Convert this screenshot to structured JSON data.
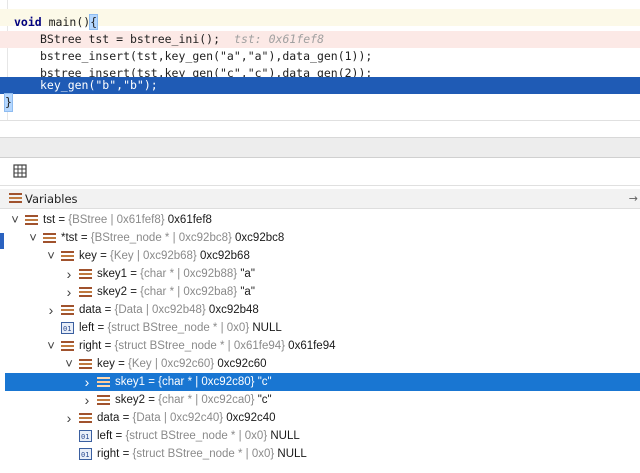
{
  "editor": {
    "lines": [
      {
        "kind": "func",
        "kw": "void",
        "rest": " main()",
        "brace": "{"
      },
      {
        "kind": "current",
        "text": "BStree tst = bstree_ini();",
        "hint": "tst: 0x61fef8"
      },
      {
        "kind": "normal",
        "text": "bstree_insert(tst,key_gen(\"a\",\"a\"),data_gen(1));"
      },
      {
        "kind": "normal",
        "text": "bstree_insert(tst,key_gen(\"c\",\"c\"),data_gen(2));"
      },
      {
        "kind": "selected",
        "text": "key_gen(\"b\",\"b\");"
      },
      {
        "kind": "closing",
        "text": "}"
      }
    ]
  },
  "toolbar": {
    "table_icon": "table-view-icon"
  },
  "variables_pane": {
    "title": "Variables",
    "pin_glyph": "→",
    "rows": [
      {
        "depth": 0,
        "twisty": "down",
        "icon": "struct",
        "name": "tst",
        "type": "{BStree | 0x61fef8}",
        "value": "0x61fef8"
      },
      {
        "depth": 1,
        "twisty": "down",
        "icon": "struct",
        "name": "*tst",
        "type": "{BStree_node * | 0xc92bc8}",
        "value": "0xc92bc8"
      },
      {
        "depth": 2,
        "twisty": "down",
        "icon": "struct",
        "name": "key",
        "type": "{Key | 0xc92b68}",
        "value": "0xc92b68"
      },
      {
        "depth": 3,
        "twisty": "right",
        "icon": "struct",
        "name": "skey1",
        "type": "{char * | 0xc92b88}",
        "value": "\"a\""
      },
      {
        "depth": 3,
        "twisty": "right",
        "icon": "struct",
        "name": "skey2",
        "type": "{char * | 0xc92ba8}",
        "value": "\"a\""
      },
      {
        "depth": 2,
        "twisty": "right",
        "icon": "struct",
        "name": "data",
        "type": "{Data | 0xc92b48}",
        "value": "0xc92b48"
      },
      {
        "depth": 2,
        "twisty": "none",
        "icon": "pointer",
        "name": "left",
        "type": "{struct BStree_node * | 0x0}",
        "value": "NULL"
      },
      {
        "depth": 2,
        "twisty": "down",
        "icon": "struct",
        "name": "right",
        "type": "{struct BStree_node * | 0x61fe94}",
        "value": "0x61fe94"
      },
      {
        "depth": 3,
        "twisty": "down",
        "icon": "struct",
        "name": "key",
        "type": "{Key | 0xc92c60}",
        "value": "0xc92c60"
      },
      {
        "depth": 4,
        "twisty": "right",
        "icon": "struct",
        "name": "skey1",
        "type": "{char * | 0xc92c80}",
        "value": "\"c\"",
        "selected": true
      },
      {
        "depth": 4,
        "twisty": "right",
        "icon": "struct",
        "name": "skey2",
        "type": "{char * | 0xc92ca0}",
        "value": "\"c\""
      },
      {
        "depth": 3,
        "twisty": "right",
        "icon": "struct",
        "name": "data",
        "type": "{Data | 0xc92c40}",
        "value": "0xc92c40"
      },
      {
        "depth": 3,
        "twisty": "none",
        "icon": "pointer",
        "name": "left",
        "type": "{struct BStree_node * | 0x0}",
        "value": "NULL"
      },
      {
        "depth": 3,
        "twisty": "none",
        "icon": "pointer",
        "name": "right",
        "type": "{struct BStree_node * | 0x0}",
        "value": "NULL"
      }
    ]
  }
}
